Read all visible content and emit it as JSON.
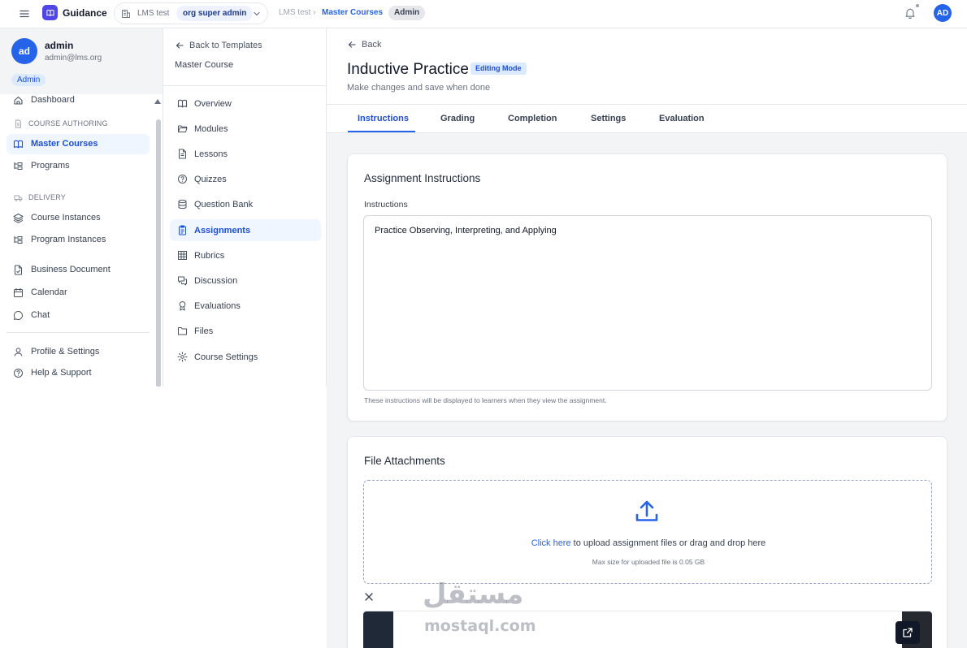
{
  "topbar": {
    "app_name": "Guidance",
    "org_name": "LMS test",
    "role_badge": "org super admin",
    "breadcrumbs": [
      "LMS test",
      "Master Courses"
    ],
    "crumb_badge": "Admin",
    "avatar_initials": "AD"
  },
  "sidebar": {
    "user": {
      "initials": "ad",
      "name": "admin",
      "email": "admin@lms.org",
      "role": "Admin"
    },
    "dashboard": "Dashboard",
    "section_authoring": "COURSE AUTHORING",
    "master_courses": "Master Courses",
    "programs": "Programs",
    "section_delivery": "DELIVERY",
    "course_instances": "Course Instances",
    "program_instances": "Program Instances",
    "business_document": "Business Document",
    "calendar": "Calendar",
    "chat": "Chat",
    "profile_settings": "Profile & Settings",
    "help_support": "Help & Support"
  },
  "course_nav": {
    "back": "Back to Templates",
    "course_name": "Master Course",
    "items": [
      "Overview",
      "Modules",
      "Lessons",
      "Quizzes",
      "Question Bank",
      "Assignments",
      "Rubrics",
      "Discussion",
      "Evaluations",
      "Files",
      "Course Settings"
    ]
  },
  "main": {
    "back": "Back",
    "title": "Inductive Practice",
    "mode_badge": "Editing Mode",
    "subtitle": "Make changes and save when done",
    "tabs": [
      "Instructions",
      "Grading",
      "Completion",
      "Settings",
      "Evaluation"
    ],
    "instructions_card": {
      "title": "Assignment Instructions",
      "label": "Instructions",
      "value": "Practice Observing, Interpreting, and Applying",
      "helper": "These instructions will be displayed to learners when they view the assignment."
    },
    "attachments_card": {
      "title": "File Attachments",
      "link": "Click here",
      "text": " to upload assignment files or drag and drop here",
      "max_size": "Max size for uploaded file is 0.05 GB"
    }
  },
  "watermark": {
    "arabic": "مستقل",
    "latin": "mostaql.com"
  },
  "colors": {
    "accent": "#2563eb",
    "brand": "#4f46e5",
    "page_bg": "#f3f4f6"
  },
  "icons": [
    "menu-icon",
    "logo-icon",
    "building-icon",
    "chevron-down-icon",
    "bell-icon",
    "arrow-left-icon",
    "upload-icon",
    "close-icon",
    "external-link-icon"
  ]
}
